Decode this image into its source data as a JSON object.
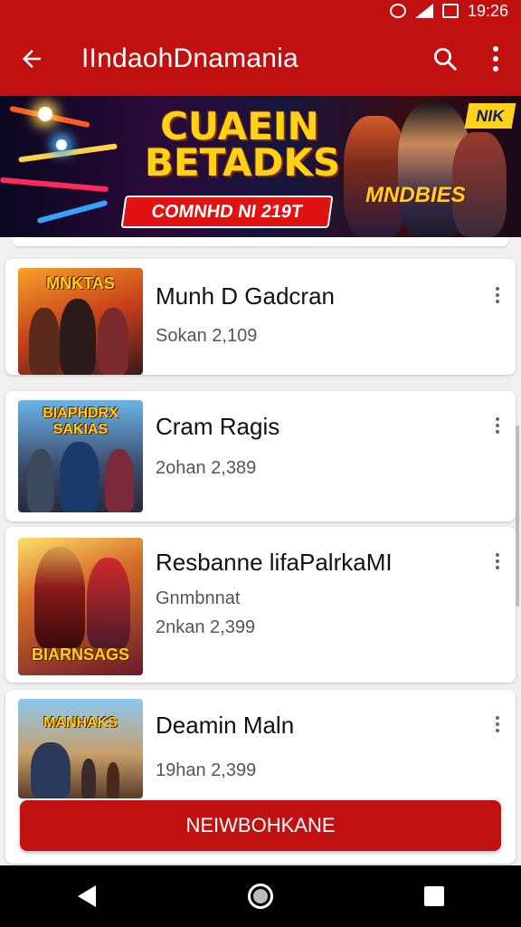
{
  "status_bar": {
    "time": "19:26"
  },
  "app_bar": {
    "title": "IIndaohDnamania"
  },
  "banner": {
    "headline": "CUAEIN BETADKS",
    "cta": "COMNHD NI 219T",
    "brand": "MNDBIES",
    "corner_badge": "NIK"
  },
  "games": [
    {
      "thumb_title": "MNKTAS",
      "name": "Munh D Gadcran",
      "meta": [
        "Sokan 2,109"
      ]
    },
    {
      "thumb_title": "BIAPHDRX SAKIAS",
      "name": "Cram Ragis",
      "meta": [
        "2ohan 2,389"
      ]
    },
    {
      "thumb_title": "BIARNSAGS",
      "name": "Resbanne lifaPalrkaMI",
      "meta": [
        "Gnmbnnat",
        "2nkan 2,399"
      ]
    },
    {
      "thumb_title": "MANHAKS",
      "name": "Deamin Maln",
      "meta": [
        "19han 2,399"
      ]
    }
  ],
  "primary_button": "NEIWBOHKANE"
}
